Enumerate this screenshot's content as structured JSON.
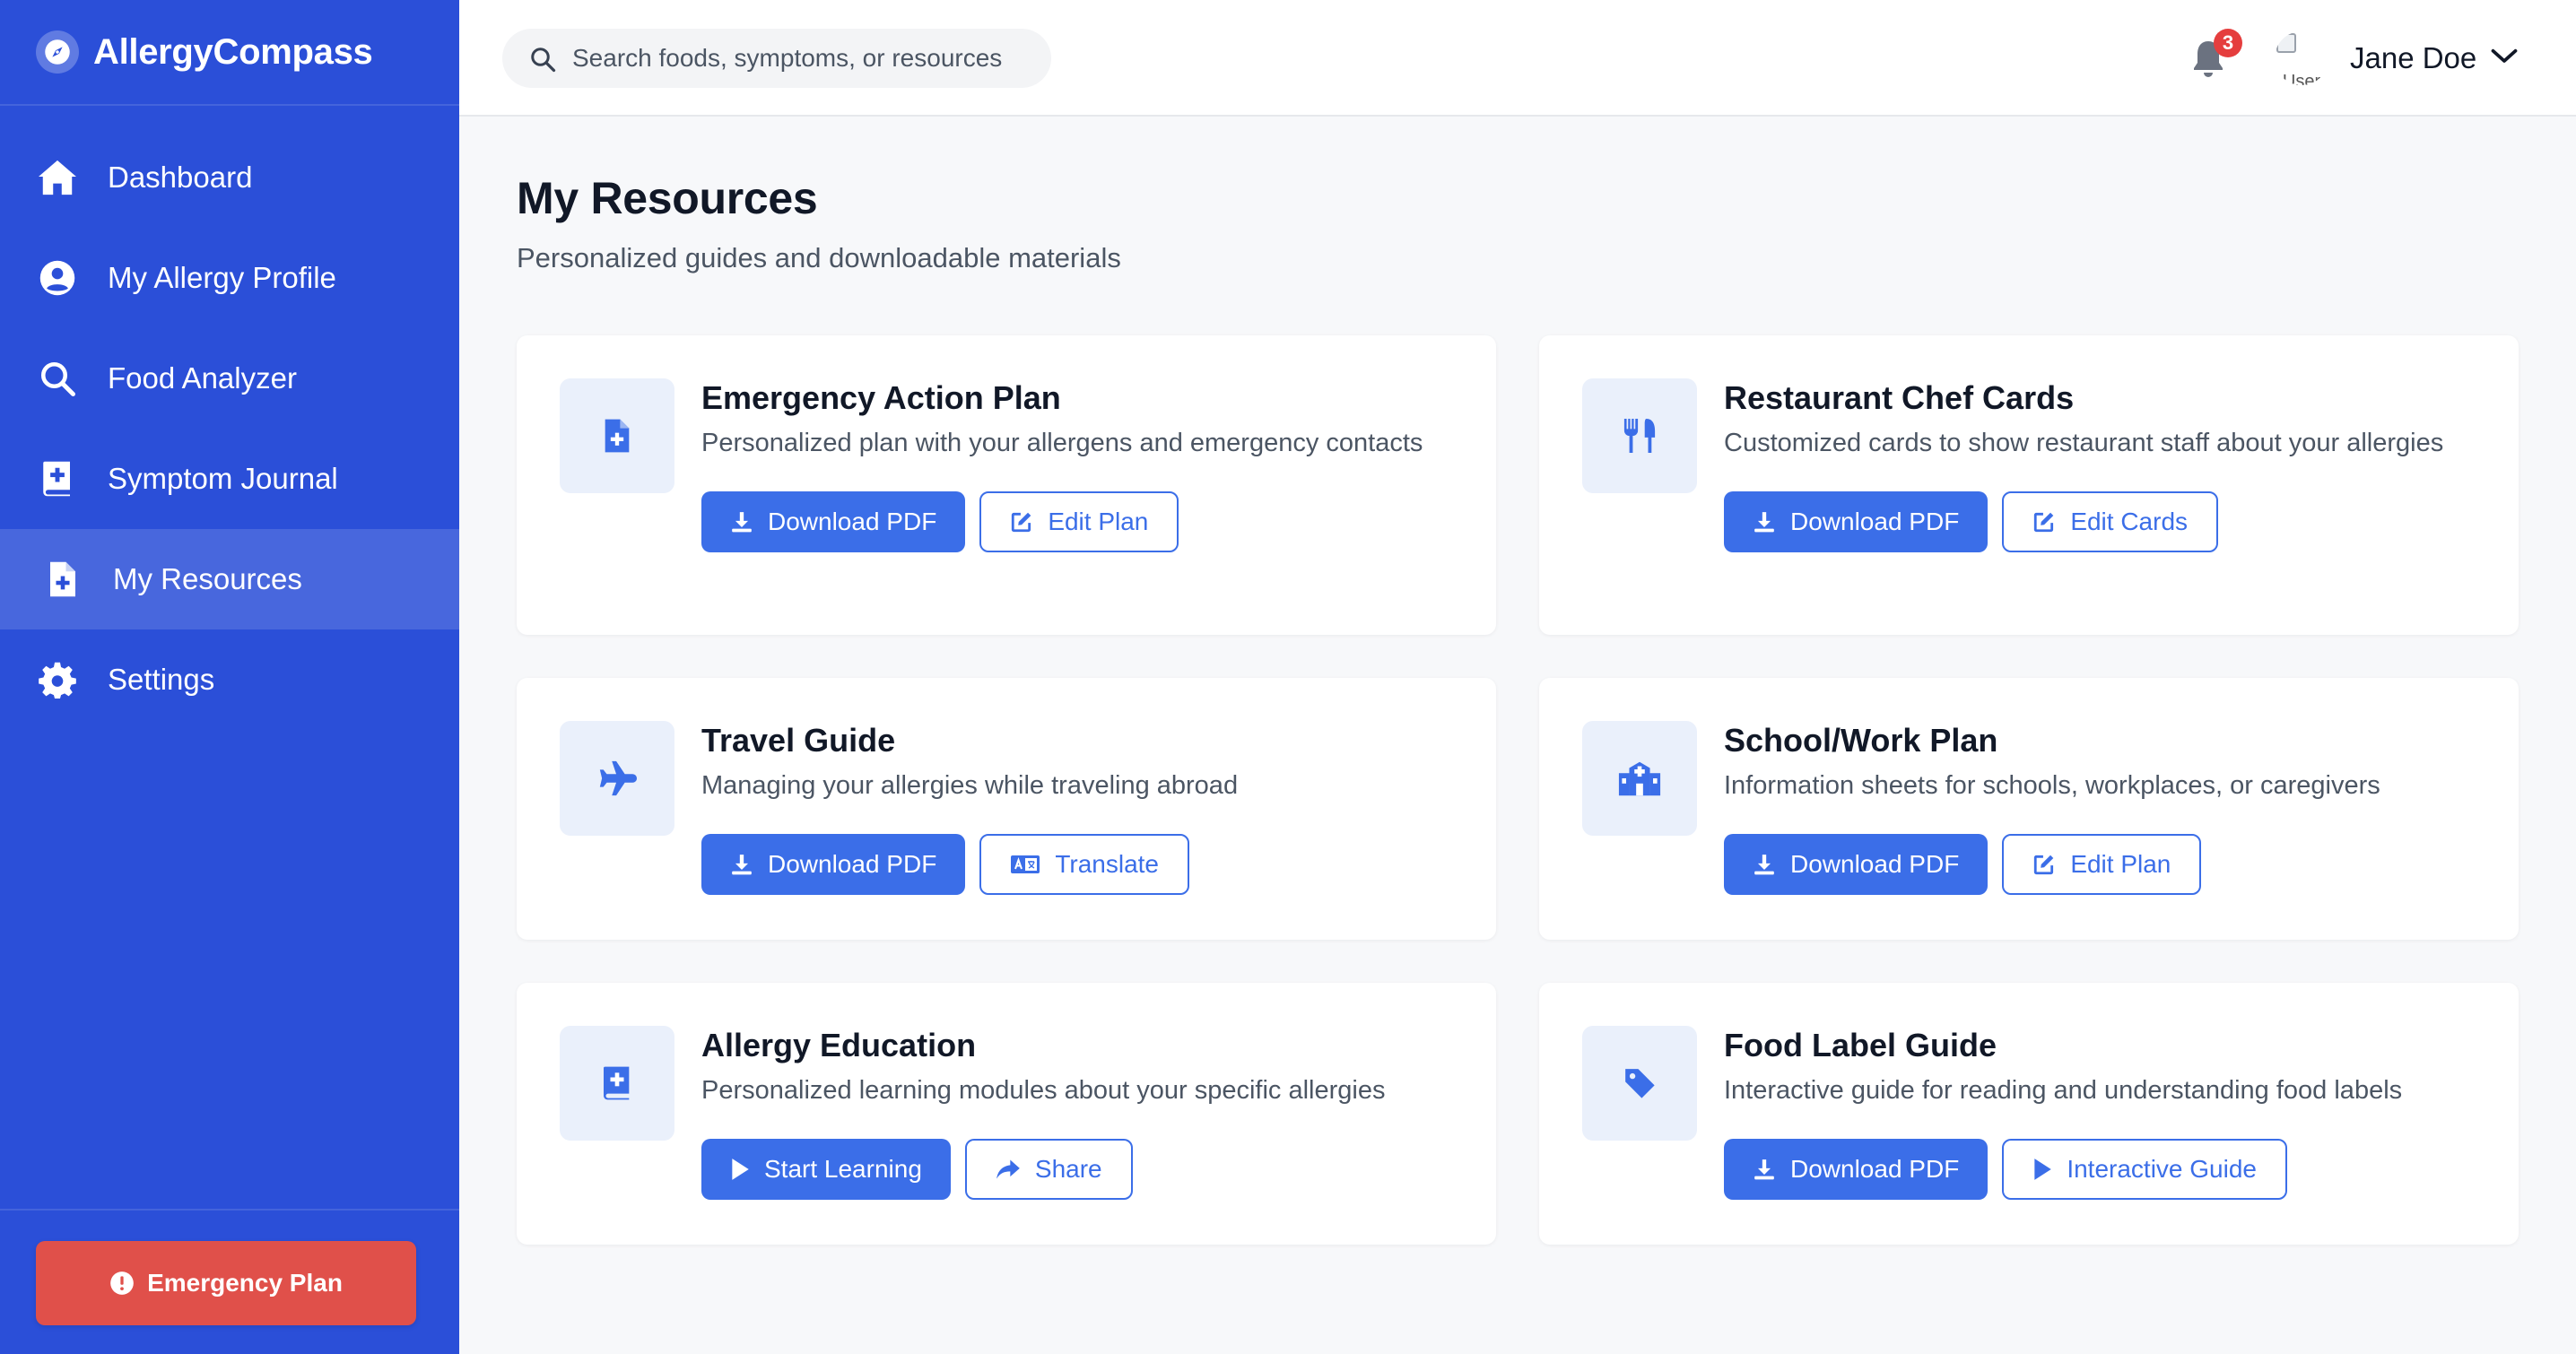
{
  "brand": {
    "name": "AllergyCompass"
  },
  "sidebar": {
    "items": [
      {
        "label": "Dashboard",
        "icon": "home-icon",
        "active": false
      },
      {
        "label": "My Allergy Profile",
        "icon": "user-circle-icon",
        "active": false
      },
      {
        "label": "Food Analyzer",
        "icon": "search-icon",
        "active": false
      },
      {
        "label": "Symptom Journal",
        "icon": "medical-book-icon",
        "active": false
      },
      {
        "label": "My Resources",
        "icon": "file-medical-icon",
        "active": true
      },
      {
        "label": "Settings",
        "icon": "gear-icon",
        "active": false
      }
    ],
    "emergency_label": "Emergency Plan"
  },
  "header": {
    "search_placeholder": "Search foods, symptoms, or resources",
    "notification_count": "3",
    "avatar_alt_text": "User",
    "user_name": "Jane Doe"
  },
  "main": {
    "title": "My Resources",
    "subtitle": "Personalized guides and downloadable materials",
    "cards": [
      {
        "title": "Emergency Action Plan",
        "description": "Personalized plan with your allergens and emergency contacts",
        "icon": "file-medical-icon",
        "primary": {
          "label": "Download PDF",
          "icon": "download-icon"
        },
        "secondary": {
          "label": "Edit Plan",
          "icon": "edit-icon"
        }
      },
      {
        "title": "Restaurant Chef Cards",
        "description": "Customized cards to show restaurant staff about your allergies",
        "icon": "utensils-icon",
        "primary": {
          "label": "Download PDF",
          "icon": "download-icon"
        },
        "secondary": {
          "label": "Edit Cards",
          "icon": "edit-icon"
        }
      },
      {
        "title": "Travel Guide",
        "description": "Managing your allergies while traveling abroad",
        "icon": "plane-icon",
        "primary": {
          "label": "Download PDF",
          "icon": "download-icon"
        },
        "secondary": {
          "label": "Translate",
          "icon": "translate-icon"
        }
      },
      {
        "title": "School/Work Plan",
        "description": "Information sheets for schools, workplaces, or caregivers",
        "icon": "school-icon",
        "primary": {
          "label": "Download PDF",
          "icon": "download-icon"
        },
        "secondary": {
          "label": "Edit Plan",
          "icon": "edit-icon"
        }
      },
      {
        "title": "Allergy Education",
        "description": "Personalized learning modules about your specific allergies",
        "icon": "medical-book-icon",
        "primary": {
          "label": "Start Learning",
          "icon": "play-icon"
        },
        "secondary": {
          "label": "Share",
          "icon": "share-icon"
        }
      },
      {
        "title": "Food Label Guide",
        "description": "Interactive guide for reading and understanding food labels",
        "icon": "tag-icon",
        "primary": {
          "label": "Download PDF",
          "icon": "download-icon"
        },
        "secondary": {
          "label": "Interactive Guide",
          "icon": "play-icon"
        }
      }
    ]
  },
  "colors": {
    "sidebar_bg": "#2b4fd8",
    "accent": "#3b6ee8",
    "emergency": "#e0504a",
    "badge": "#e53e3e",
    "icon_tile_bg": "#eaf0fb"
  }
}
